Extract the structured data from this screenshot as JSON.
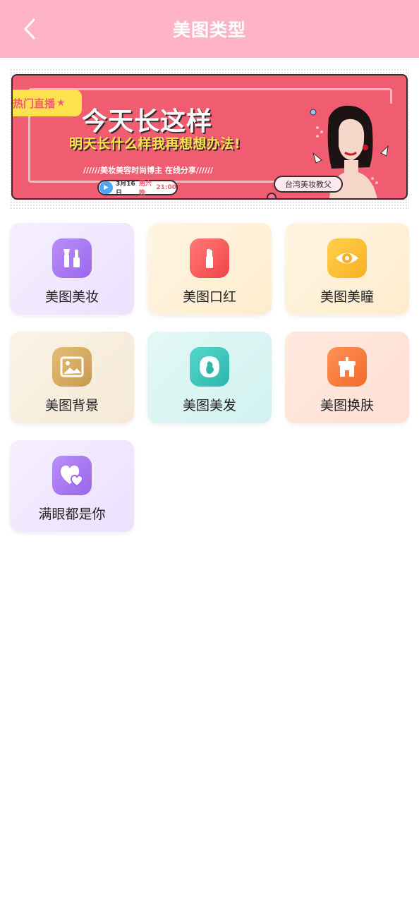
{
  "header": {
    "title": "美图类型"
  },
  "banner": {
    "hot_tag": "热门直播",
    "headline": "今天长这样",
    "subline": "明天长什么样我再想想办法!",
    "info_line": "//////美妆美容时尚博主 在线分享//////",
    "date": "3月16日",
    "weekday": "周六晚",
    "time": "21:00",
    "host": "台湾美妆教父"
  },
  "categories": [
    {
      "label": "美图美妆",
      "icon": "cosmetics-icon",
      "bg": "#f1e8ff",
      "icon_color": "#a77bf2"
    },
    {
      "label": "美图口红",
      "icon": "lipstick-icon",
      "bg": "#fff1da",
      "icon_color": "#f4575a"
    },
    {
      "label": "美图美瞳",
      "icon": "eye-icon",
      "bg": "#fff1da",
      "icon_color": "#f9bb2a"
    },
    {
      "label": "美图背景",
      "icon": "image-icon",
      "bg": "#f8eedf",
      "icon_color": "#d9ae62"
    },
    {
      "label": "美图美发",
      "icon": "hair-icon",
      "bg": "#d9f4f2",
      "icon_color": "#3fc6bd"
    },
    {
      "label": "美图换肤",
      "icon": "skin-icon",
      "bg": "#ffe3d9",
      "icon_color": "#f47a3b"
    },
    {
      "label": "满眼都是你",
      "icon": "hearts-icon",
      "bg": "#f1e8ff",
      "icon_color": "#a77bf2"
    }
  ]
}
